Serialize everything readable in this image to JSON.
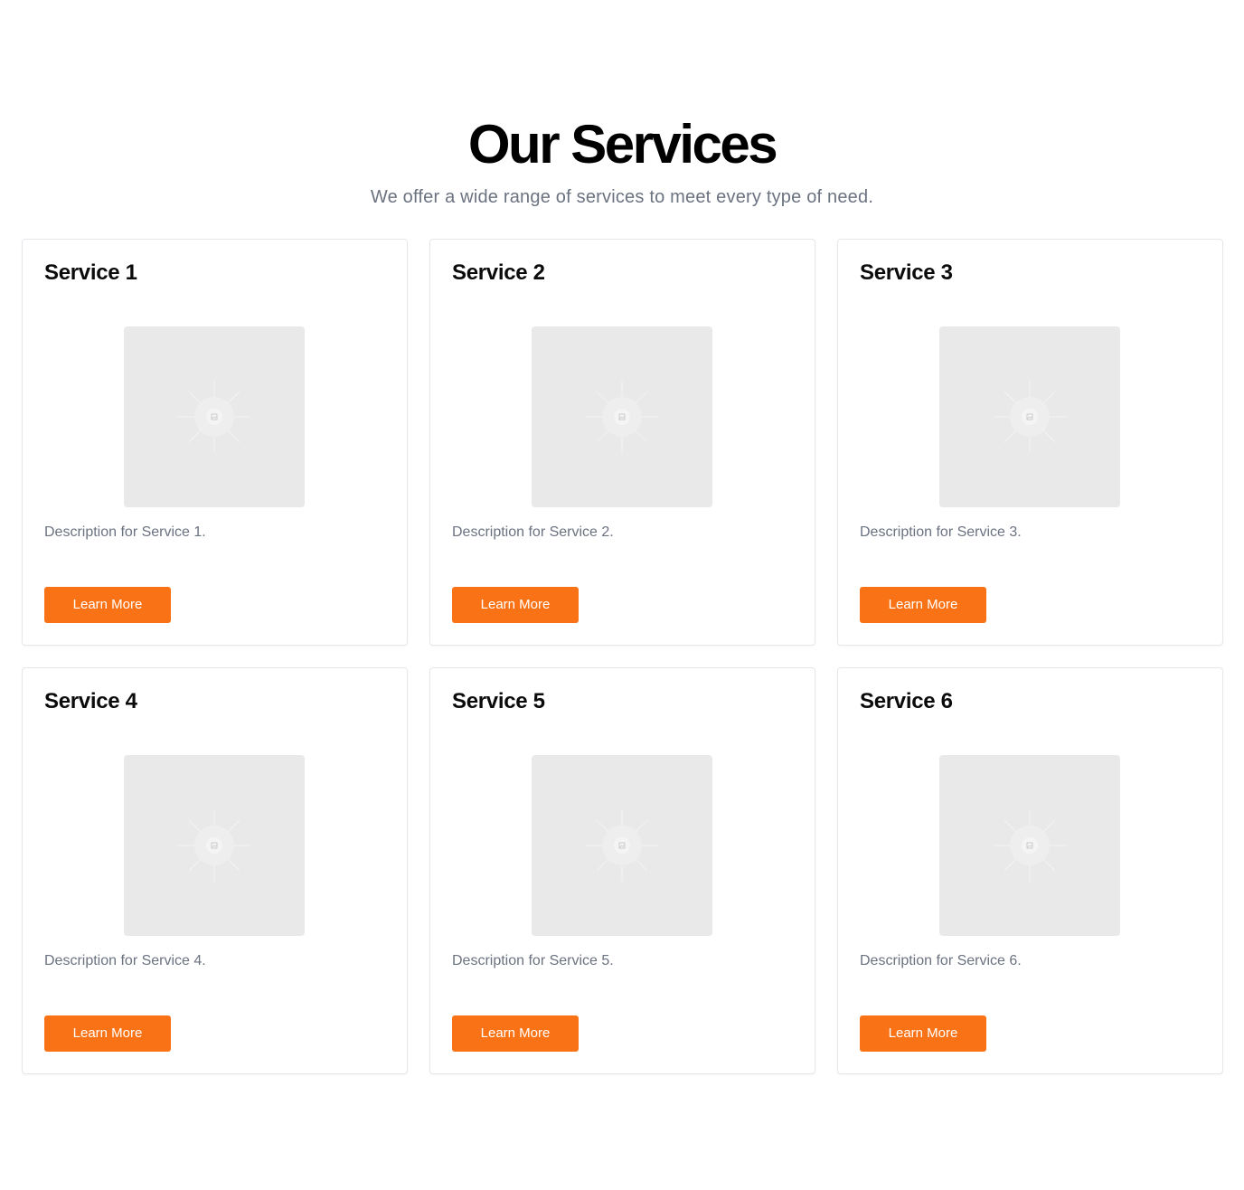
{
  "header": {
    "title": "Our Services",
    "subtitle": "We offer a wide range of services to meet every type of need."
  },
  "colors": {
    "accent": "#f97316",
    "muted_text": "#6b7280",
    "placeholder_bg": "#e9e9e9",
    "card_border": "#e5e7eb"
  },
  "services": [
    {
      "title": "Service 1",
      "description": "Description for Service 1.",
      "button_label": "Learn More",
      "image_icon": "image-placeholder-icon"
    },
    {
      "title": "Service 2",
      "description": "Description for Service 2.",
      "button_label": "Learn More",
      "image_icon": "image-placeholder-icon"
    },
    {
      "title": "Service 3",
      "description": "Description for Service 3.",
      "button_label": "Learn More",
      "image_icon": "image-placeholder-icon"
    },
    {
      "title": "Service 4",
      "description": "Description for Service 4.",
      "button_label": "Learn More",
      "image_icon": "image-placeholder-icon"
    },
    {
      "title": "Service 5",
      "description": "Description for Service 5.",
      "button_label": "Learn More",
      "image_icon": "image-placeholder-icon"
    },
    {
      "title": "Service 6",
      "description": "Description for Service 6.",
      "button_label": "Learn More",
      "image_icon": "image-placeholder-icon"
    }
  ]
}
